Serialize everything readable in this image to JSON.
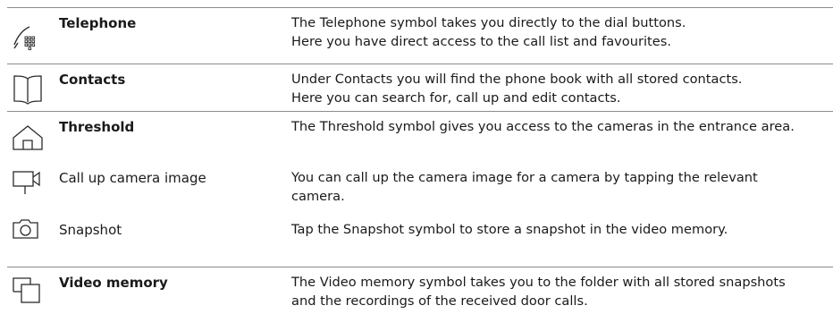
{
  "rows": [
    {
      "label": "Telephone",
      "icon": "telephone-icon",
      "lines": [
        "The Telephone symbol takes you directly to the dial buttons.",
        "Here you have direct access to the call list and favourites."
      ]
    },
    {
      "label": "Contacts",
      "icon": "book-icon",
      "lines": [
        "Under Contacts you will find the phone book with all stored contacts.",
        "Here you can search for, call up and edit contacts."
      ]
    },
    {
      "label": "Threshold",
      "icon": "house-icon",
      "lines": [
        "The Threshold symbol gives you access to the cameras in the entrance area."
      ]
    },
    {
      "label": "Call up camera image",
      "icon": "video-camera-icon",
      "lines": [
        "You can call up the camera image for a camera by tapping the relevant",
        "camera."
      ]
    },
    {
      "label": "Snapshot",
      "icon": "camera-icon",
      "lines": [
        "Tap the Snapshot symbol to store a snapshot in the video memory."
      ]
    },
    {
      "label": "Video memory",
      "icon": "video-memory-icon",
      "lines": [
        "The Video memory symbol takes you to the folder with all stored snapshots",
        "and the recordings of the received door calls."
      ]
    }
  ]
}
